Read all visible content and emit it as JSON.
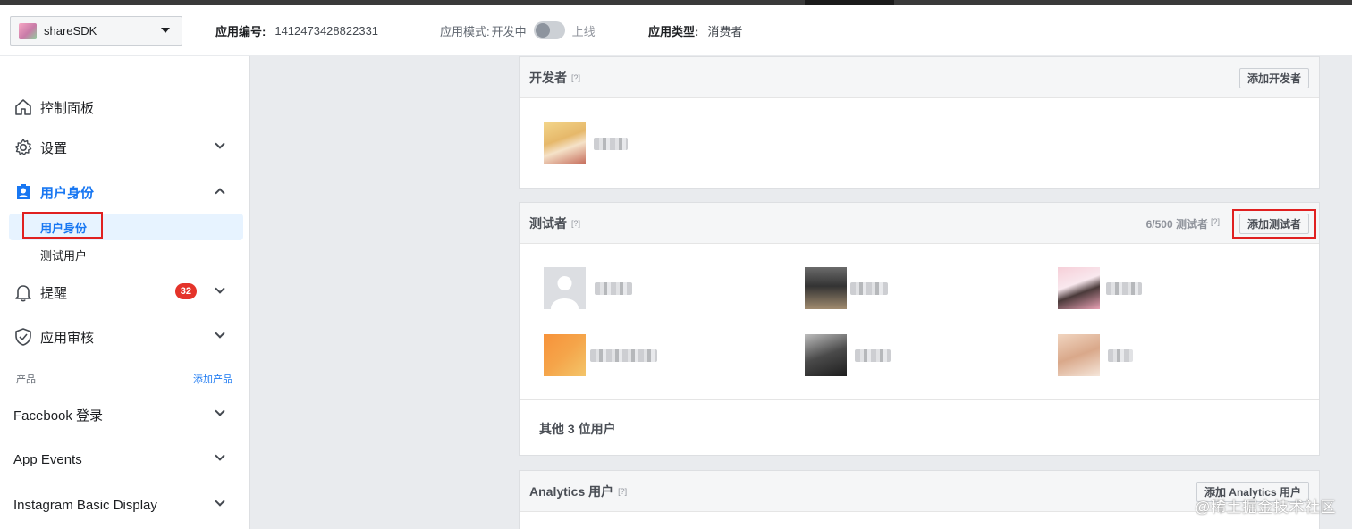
{
  "header": {
    "app_name": "shareSDK",
    "app_id_label": "应用编号:",
    "app_id": "1412473428822331",
    "mode_label": "应用模式:",
    "mode_dev": "开发中",
    "mode_live": "上线",
    "type_label": "应用类型:",
    "type_value": "消费者"
  },
  "sidebar": {
    "items": [
      {
        "label": "控制面板",
        "icon": "home-icon"
      },
      {
        "label": "设置",
        "icon": "gear-icon"
      },
      {
        "label": "用户身份",
        "icon": "user-badge-icon"
      },
      {
        "label": "提醒",
        "icon": "bell-icon",
        "badge": "32"
      },
      {
        "label": "应用审核",
        "icon": "shield-check-icon"
      }
    ],
    "sub_items": [
      "用户身份",
      "测试用户"
    ],
    "products_label": "产品",
    "add_product_link": "添加产品",
    "products": [
      "Facebook 登录",
      "App Events",
      "Instagram Basic Display"
    ]
  },
  "developers_panel": {
    "title": "开发者",
    "help": "[?]",
    "add_button": "添加开发者"
  },
  "testers_panel": {
    "title": "测试者",
    "help": "[?]",
    "count": "6/500 测试者",
    "count_help": "[?]",
    "add_button": "添加测试者",
    "other_users": "其他 3 位用户"
  },
  "analytics_panel": {
    "title": "Analytics 用户",
    "help": "[?]",
    "add_button": "添加 Analytics 用户"
  },
  "watermark": "@稀土掘金技术社区",
  "colors": {
    "accent": "#1877f2",
    "badge": "#e4332a",
    "highlight_box": "#e02020",
    "background": "#e9ebee"
  }
}
